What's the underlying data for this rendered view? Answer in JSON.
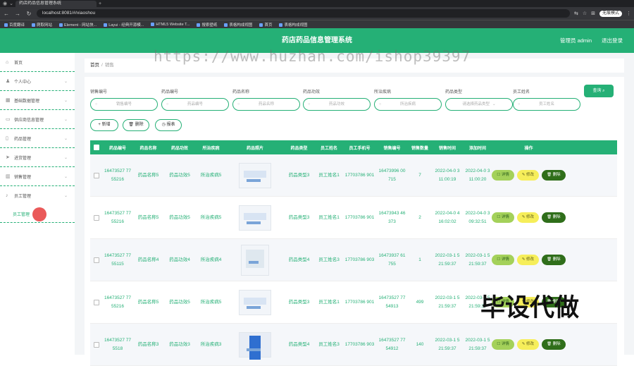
{
  "browser": {
    "tab_title": "药店药品信息管理系统",
    "url": "localhost:8081/#/xiaoshou",
    "profile": "无痕模式",
    "bookmarks": [
      "百度翻译",
      "爬取网站",
      "Element - 网站快...",
      "Layui - 经典开源模...",
      "HTML5 Website T...",
      "搜索壁纸",
      "表格构成视图",
      "首页",
      "表格构成视图"
    ]
  },
  "header": {
    "title": "药店药品信息管理系统",
    "user": "管理员 admin",
    "logout": "退出登录"
  },
  "sidebar": {
    "items": [
      {
        "label": "首页",
        "icon": "home-icon"
      },
      {
        "label": "个人中心",
        "icon": "user-icon"
      },
      {
        "label": "基础数据管理",
        "icon": "grid-icon"
      },
      {
        "label": "供应商信息管理",
        "icon": "chat-icon"
      },
      {
        "label": "药品管理",
        "icon": "file-icon"
      },
      {
        "label": "进货管理",
        "icon": "send-icon"
      },
      {
        "label": "销售管理",
        "icon": "chart-icon"
      },
      {
        "label": "员工管理",
        "icon": "mic-icon"
      }
    ],
    "sub_item": "员工管理"
  },
  "breadcrumb": {
    "home": "首页",
    "sep": "/",
    "current": "销售"
  },
  "filters": [
    {
      "label": "销售编号",
      "placeholder": "销售编号"
    },
    {
      "label": "药品编号",
      "placeholder": "药品编号"
    },
    {
      "label": "药品名称",
      "placeholder": "药品名称"
    },
    {
      "label": "药品功效",
      "placeholder": "药品功效"
    },
    {
      "label": "所治疾病",
      "placeholder": "所治疾病"
    },
    {
      "label": "药品类型",
      "placeholder": "请选择药品类型"
    },
    {
      "label": "员工姓名",
      "placeholder": "员工姓名"
    }
  ],
  "search_label": "查询",
  "actions": {
    "add": "+ 新增",
    "delete": "删除",
    "report": "报表"
  },
  "columns": [
    "药品编号",
    "药品名称",
    "药品功效",
    "所治疾病",
    "药品照片",
    "药品类型",
    "员工姓名",
    "员工手机号",
    "销售编号",
    "销售数量",
    "销售时间",
    "添加时间",
    "操作"
  ],
  "rows": [
    {
      "code": "16473527 7755216",
      "name": "药品名称5",
      "effect": "药品功效5",
      "disease": "所治疾病5",
      "type": "药品类型3",
      "staff": "员工姓名1",
      "phone": "17703786 901",
      "sale_no": "16473996 00715",
      "qty": "7",
      "sale_time": "2022-04-0 3 11:00:19",
      "add_time": "2022-04-0 3 11:00:20"
    },
    {
      "code": "16473527 7755216",
      "name": "药品名称5",
      "effect": "药品功效5",
      "disease": "所治疾病5",
      "type": "药品类型3",
      "staff": "员工姓名1",
      "phone": "17703786 901",
      "sale_no": "16473943 46373",
      "qty": "2",
      "sale_time": "2022-04-0 4 16:02:02",
      "add_time": "2022-04-0 3 09:32:51"
    },
    {
      "code": "16473527 7755115",
      "name": "药品名称4",
      "effect": "药品功效4",
      "disease": "所治疾病4",
      "type": "药品类型4",
      "staff": "员工姓名3",
      "phone": "17703786 903",
      "sale_no": "16473937 61755",
      "qty": "1",
      "sale_time": "2022-03-1 5 21:59:37",
      "add_time": "2022-03-1 5 21:59:37"
    },
    {
      "code": "16473527 7755216",
      "name": "药品名称5",
      "effect": "药品功效5",
      "disease": "所治疾病5",
      "type": "药品类型3",
      "staff": "员工姓名1",
      "phone": "17703786 901",
      "sale_no": "16473527 7754913",
      "qty": "499",
      "sale_time": "2022-03-1 5 21:59:37",
      "add_time": "2022-03-1 5 21:59:37"
    },
    {
      "code": "16473527 775518",
      "name": "药品名称3",
      "effect": "药品功效3",
      "disease": "所治疾病3",
      "type": "药品类型4",
      "staff": "员工姓名3",
      "phone": "17703786 903",
      "sale_no": "16473527 7754912",
      "qty": "140",
      "sale_time": "2022-03-1 5 21:59:37",
      "add_time": "2022-03-1 5 21:59:37"
    }
  ],
  "row_ops": {
    "detail": "详情",
    "edit": "修改",
    "delete": "删除"
  },
  "watermark_url": "https://www.huzhan.com/ishop39397",
  "watermark_text": "毕设代做"
}
